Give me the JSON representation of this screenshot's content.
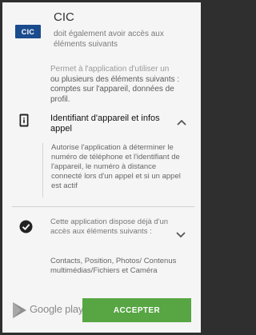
{
  "header": {
    "logo_text": "CIC",
    "app_name": "CIC",
    "subtitle": "doit également avoir accès aux éléments suivants"
  },
  "permissions": {
    "top_text_line1": "Permet à l'application d'utiliser un",
    "top_text_rest": "ou plusieurs des éléments suivants : comptes sur l'appareil, données de profil.",
    "group_title": "Identifiant d'appareil et infos appel",
    "group_detail": "Autorise l'application à déterminer le numéro de téléphone et l'identifiant de l'appareil, le numéro à distance connecté lors d'un appel et si un appel est actif",
    "already_text": "Cette application dispose déjà d'un accès aux éléments suivants :",
    "already_list": "Contacts, Position, Photos/ Contenus multimédias/Fichiers et Caméra"
  },
  "footer": {
    "store_name": "Google play",
    "accept_label": "ACCEPTER"
  },
  "colors": {
    "accent_green": "#57a543",
    "logo_blue": "#1a4b8e"
  }
}
